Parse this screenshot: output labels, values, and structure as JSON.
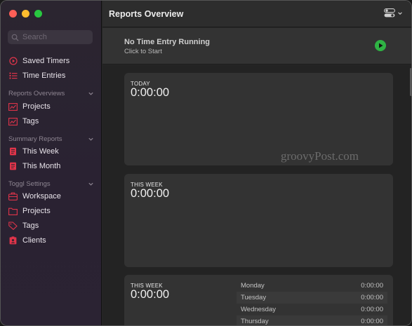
{
  "sidebar": {
    "search_placeholder": "Search",
    "items": [
      {
        "label": "Saved Timers"
      },
      {
        "label": "Time Entries"
      }
    ],
    "reports_overviews": {
      "header": "Reports Overviews",
      "items": [
        {
          "label": "Projects"
        },
        {
          "label": "Tags"
        }
      ]
    },
    "summary_reports": {
      "header": "Summary Reports",
      "items": [
        {
          "label": "This Week"
        },
        {
          "label": "This Month"
        }
      ]
    },
    "toggl_settings": {
      "header": "Toggl Settings",
      "items": [
        {
          "label": "Workspace"
        },
        {
          "label": "Projects"
        },
        {
          "label": "Tags"
        },
        {
          "label": "Clients"
        }
      ]
    }
  },
  "header": {
    "title": "Reports Overview"
  },
  "running": {
    "title": "No Time Entry Running",
    "subtitle": "Click to Start"
  },
  "cards": [
    {
      "label": "TODAY",
      "time": "0:00:00"
    },
    {
      "label": "THIS WEEK",
      "time": "0:00:00"
    },
    {
      "label": "THIS WEEK",
      "time": "0:00:00"
    }
  ],
  "days": [
    {
      "day": "Monday",
      "time": "0:00:00"
    },
    {
      "day": "Tuesday",
      "time": "0:00:00"
    },
    {
      "day": "Wednesday",
      "time": "0:00:00"
    },
    {
      "day": "Thursday",
      "time": "0:00:00"
    }
  ],
  "watermark": "groovyPost.com",
  "colors": {
    "accent_red": "#e0344a",
    "play_green": "#2fb344"
  }
}
